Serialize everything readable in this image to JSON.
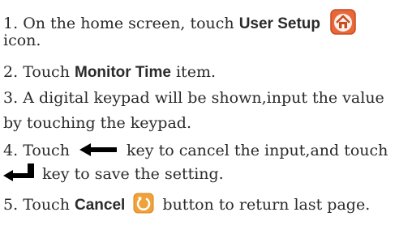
{
  "steps": [
    {
      "num": "1.",
      "pre": "On the home screen, touch",
      "bold": "User Setup",
      "icon": "home-icon",
      "post_line2": "icon."
    },
    {
      "num": "2.",
      "pre": "Touch",
      "bold": "Monitor Time",
      "post": "item."
    },
    {
      "num": "3.",
      "text_line1": "A digital keypad will be shown,input the value",
      "text_line2": "by touching the keypad."
    },
    {
      "num": "4.",
      "pre": "Touch",
      "icon1": "backspace-arrow-icon",
      "mid": "key to cancel the input,and touch",
      "icon2": "enter-arrow-icon",
      "post_line2": "key to save the setting."
    },
    {
      "num": "5.",
      "pre": "Touch",
      "bold": "Cancel",
      "icon": "cancel-icon",
      "post": "button to return last page."
    }
  ],
  "colors": {
    "text": "#2a2a2a",
    "home_icon_bg": "#e8683a",
    "home_icon_border": "#c94a1e",
    "cancel_icon_bg": "#f0a23a",
    "arrow": "#000000"
  }
}
